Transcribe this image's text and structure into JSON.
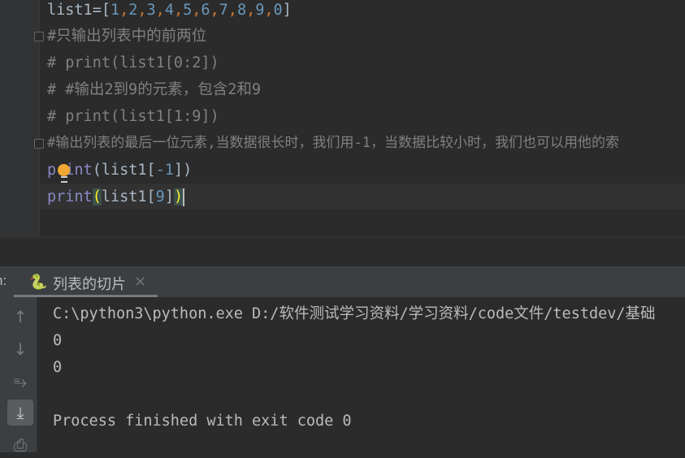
{
  "editor": {
    "line1": {
      "a": "list1=[",
      "nums": [
        "1",
        "2",
        "3",
        "4",
        "5",
        "6",
        "7",
        "8",
        "9",
        "0"
      ],
      "sep": ",",
      "z": "]"
    },
    "line2": "#只输出列表中的前两位",
    "line3": "# print(list1[0:2])",
    "line4": "# #输出2到9的元素，包含2和9",
    "line5": "# print(list1[1:9])",
    "line6": "#输出列表的最后一位元素,当数据很长时，我们用-1，当数据比较小时，我们也可以用他的索",
    "line7": {
      "kw": "print",
      "a": "(list1[",
      "n": "-1",
      "z": "])"
    },
    "line8": {
      "kw": "print",
      "open": "(",
      "a": "list1[",
      "n": "9",
      "b": "]",
      "close": ")"
    }
  },
  "run": {
    "label": "n:",
    "tab_label": "列表的切片",
    "tab_icon": "python-icon",
    "close": "×"
  },
  "console": {
    "lines": [
      "C:\\python3\\python.exe D:/软件测试学习资料/学习资料/code文件/testdev/基础",
      "0",
      "0",
      "",
      "Process finished with exit code 0"
    ]
  },
  "colors": {
    "bg": "#2b2b2b",
    "comment": "#808080",
    "number": "#6897bb",
    "punct": "#cc7832",
    "builtin": "#8888c6"
  }
}
